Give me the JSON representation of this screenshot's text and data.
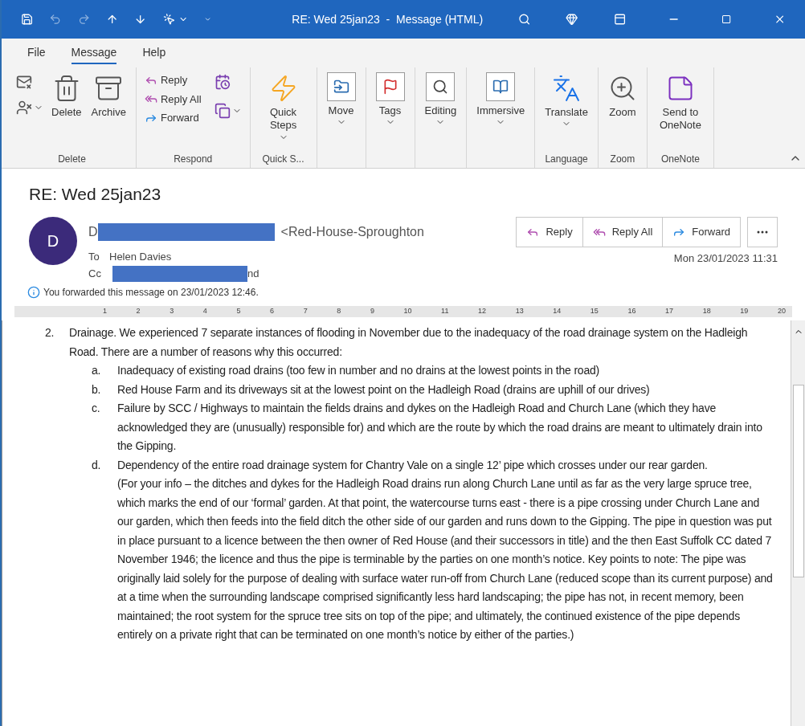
{
  "window": {
    "title": "RE: Wed 25jan23  -  Message (HTML)"
  },
  "menu_tabs": [
    {
      "label": "File",
      "selected": false
    },
    {
      "label": "Message",
      "selected": true
    },
    {
      "label": "Help",
      "selected": false
    }
  ],
  "ribbon_groups": [
    {
      "label": "Delete",
      "buttons": [
        {
          "kind": "icon",
          "caret": false
        },
        {
          "kind": "icon",
          "caret": true
        },
        {
          "kind": "large",
          "label": "Delete",
          "caret": false
        },
        {
          "kind": "large",
          "label": "Archive",
          "caret": false
        }
      ]
    },
    {
      "label": "Respond",
      "buttons": [
        {
          "kind": "small",
          "label": "Reply",
          "caret": false
        },
        {
          "kind": "small",
          "label": "Reply All",
          "caret": false
        },
        {
          "kind": "small",
          "label": "Forward",
          "caret": false
        },
        {
          "kind": "icon",
          "caret": false
        },
        {
          "kind": "icon",
          "caret": true
        }
      ]
    },
    {
      "label": "Quick S...",
      "buttons": [
        {
          "kind": "large",
          "label": "Quick Steps",
          "caret": true
        }
      ]
    },
    {
      "buttons": [
        {
          "kind": "boxed",
          "label": "Move",
          "caret": true
        }
      ]
    },
    {
      "buttons": [
        {
          "kind": "boxed",
          "label": "Tags",
          "caret": true
        }
      ]
    },
    {
      "buttons": [
        {
          "kind": "boxed",
          "label": "Editing",
          "caret": true
        }
      ]
    },
    {
      "buttons": [
        {
          "kind": "boxed",
          "label": "Immersive",
          "caret": true
        }
      ]
    },
    {
      "label": "Language",
      "buttons": [
        {
          "kind": "large",
          "label": "Translate",
          "caret": true
        }
      ]
    },
    {
      "label": "Zoom",
      "buttons": [
        {
          "kind": "large",
          "label": "Zoom",
          "caret": false
        }
      ]
    },
    {
      "label": "OneNote",
      "buttons": [
        {
          "kind": "large",
          "label": "Send to OneNote",
          "caret": false
        }
      ]
    }
  ],
  "message": {
    "subject": "RE: Wed 25jan23",
    "avatar": "D",
    "sender_prefix": "D",
    "sender_suffix": "<Red-House-Sproughton",
    "to_label": "To",
    "to": "Helen Davies",
    "cc_label": "Cc",
    "cc_suffix": "nd",
    "date": "Mon 23/01/2023 11:31",
    "notice": "You forwarded this message on 23/01/2023 12:46.",
    "actions": [
      "Reply",
      "Reply All",
      "Forward"
    ]
  },
  "ruler": [
    "1",
    "2",
    "3",
    "4",
    "5",
    "6",
    "7",
    "8",
    "9",
    "10",
    "11",
    "12",
    "13",
    "14",
    "15",
    "16",
    "17",
    "18",
    "19",
    "20"
  ],
  "body": {
    "number": "2.",
    "text": "Drainage. We experienced 7 separate instances of flooding in November due to the inadequacy of the road drainage system on the Hadleigh Road. There are a number of reasons why this occurred:",
    "items": [
      {
        "marker": "a.",
        "text": "Inadequacy of existing road drains (too few in number and no drains at the lowest points in the road)"
      },
      {
        "marker": "b.",
        "text": "Red House Farm and its driveways sit at the lowest point on the Hadleigh Road (drains are uphill of our drives)"
      },
      {
        "marker": "c.",
        "text": "Failure by SCC / Highways to maintain the fields drains and dykes on the Hadleigh Road and Church Lane (which they have acknowledged they are (unusually) responsible for) and which are the route by which the road drains are meant to ultimately drain into the Gipping."
      },
      {
        "marker": "d.",
        "text": "Dependency of the entire road drainage system for Chantry Vale on a single 12’ pipe which crosses under our rear garden."
      }
    ],
    "note": "(For your info – the ditches and dykes for the Hadleigh Road drains run along Church Lane until as far as the very large spruce tree, which marks the end of our ‘formal’ garden. At that point, the watercourse turns east - there is a pipe crossing under Church Lane and our garden, which then feeds into the field ditch the other side of our garden and runs down to the Gipping. The pipe in question was put in place pursuant to a licence between the then owner of Red House (and their successors in title) and the then East Suffolk CC dated 7 November 1946; the licence and thus the pipe is terminable by the parties on one month’s notice.  Key points to note: The pipe was originally laid solely for the purpose of dealing with surface water run-off from Church Lane (reduced scope than its current purpose) and at a time when the surrounding landscape comprised significantly less hard landscaping; the pipe has not, in recent memory, been maintained; the root system for the spruce tree sits on top of the pipe; and ultimately, the continued existence of the pipe depends entirely on a private right that can be terminated on one month’s notice by either of the parties.)"
  }
}
